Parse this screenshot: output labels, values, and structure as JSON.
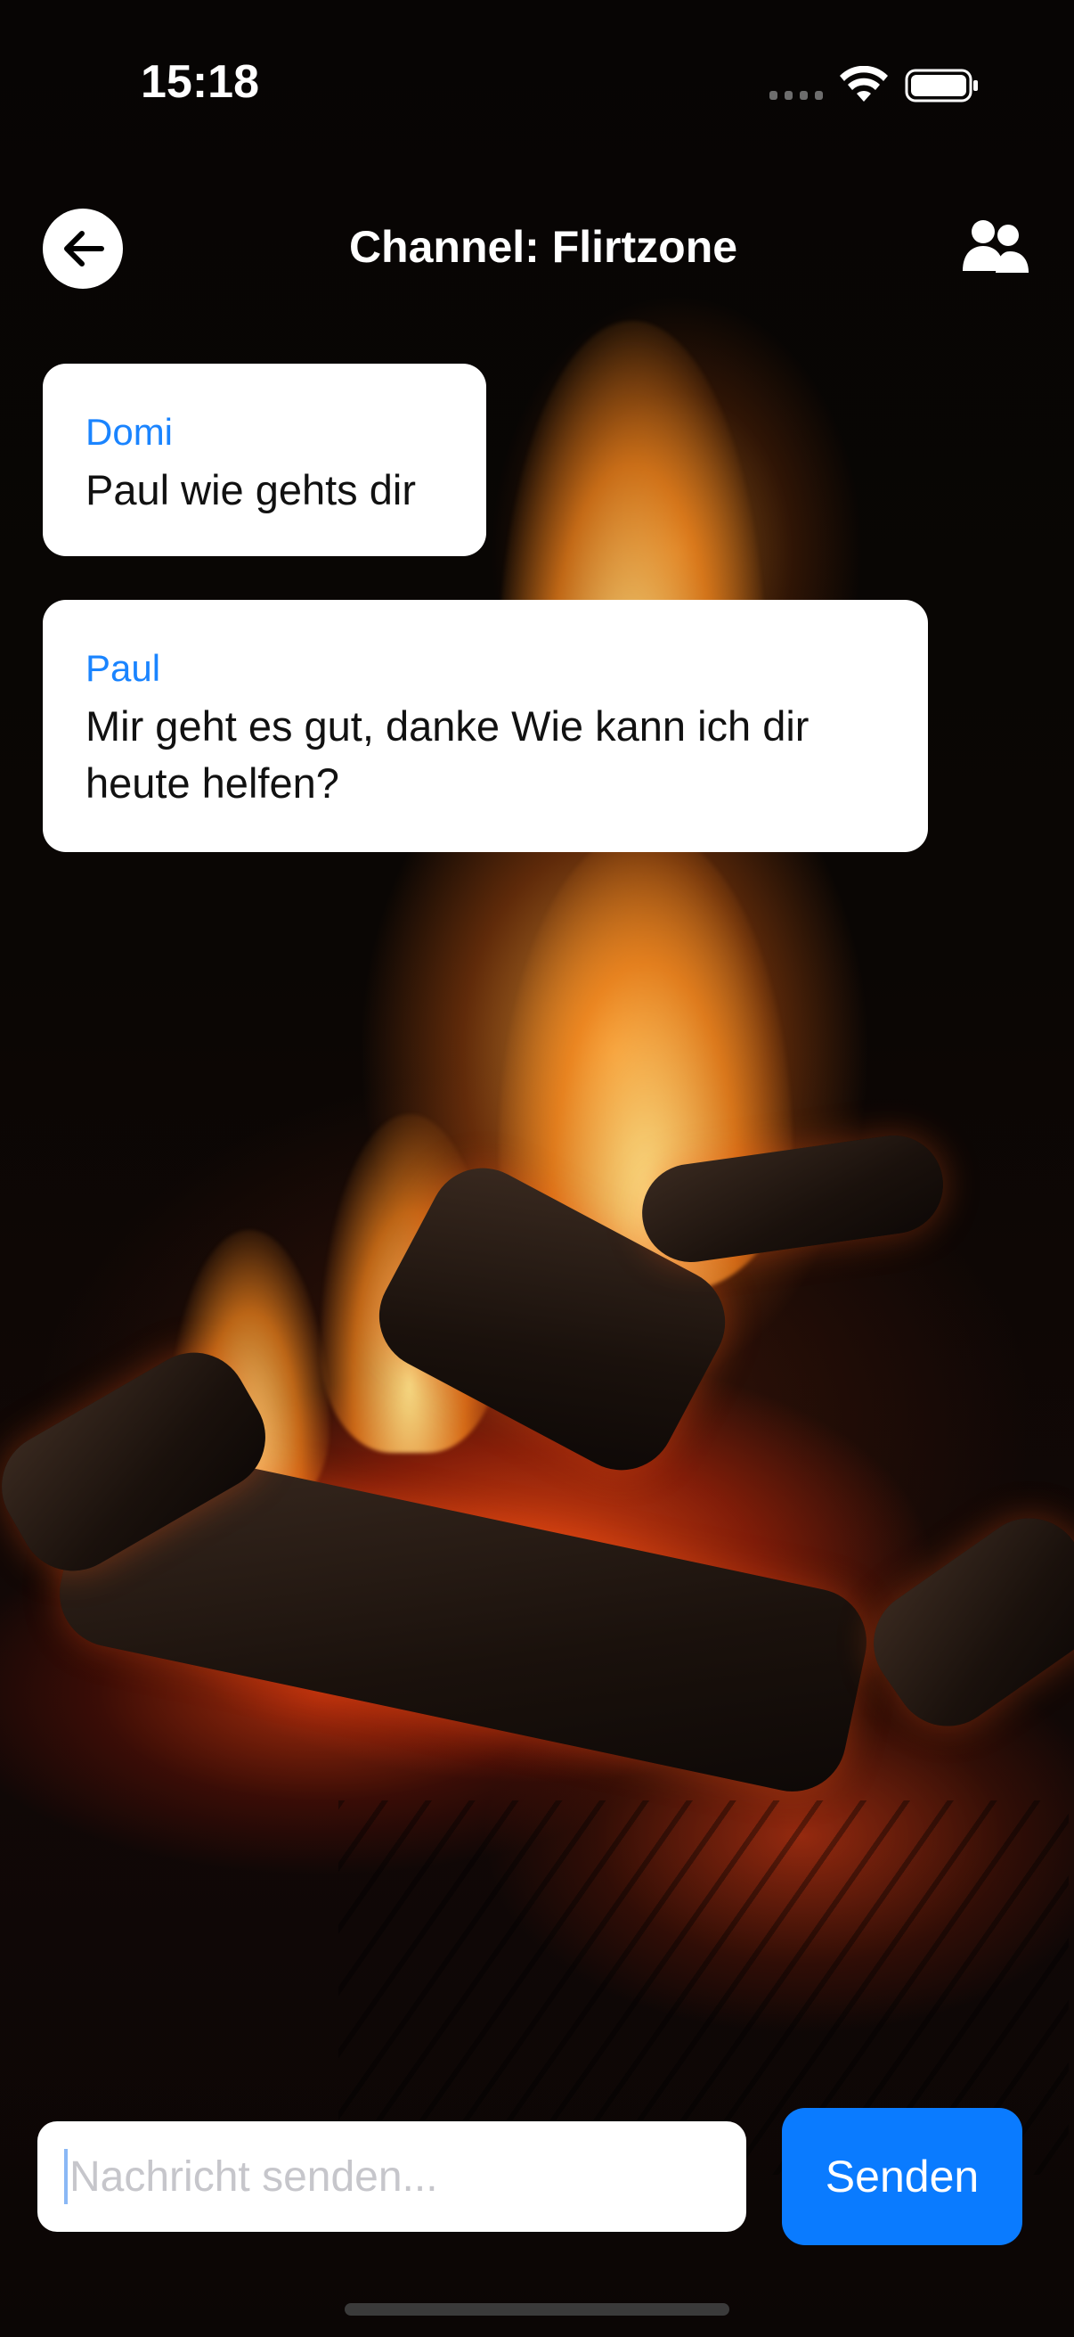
{
  "status_bar": {
    "time": "15:18"
  },
  "header": {
    "title": "Channel: Flirtzone",
    "back_icon": "arrow-left-icon",
    "members_icon": "users-icon"
  },
  "messages": [
    {
      "sender": "Domi",
      "text": "Paul wie gehts dir"
    },
    {
      "sender": "Paul",
      "text": "Mir geht es gut, danke Wie kann ich dir heute helfen?"
    }
  ],
  "composer": {
    "placeholder": "Nachricht senden...",
    "send_label": "Senden"
  },
  "colors": {
    "accent": "#0a7bff",
    "sender_name": "#1a84ff",
    "bubble": "#ffffff"
  }
}
